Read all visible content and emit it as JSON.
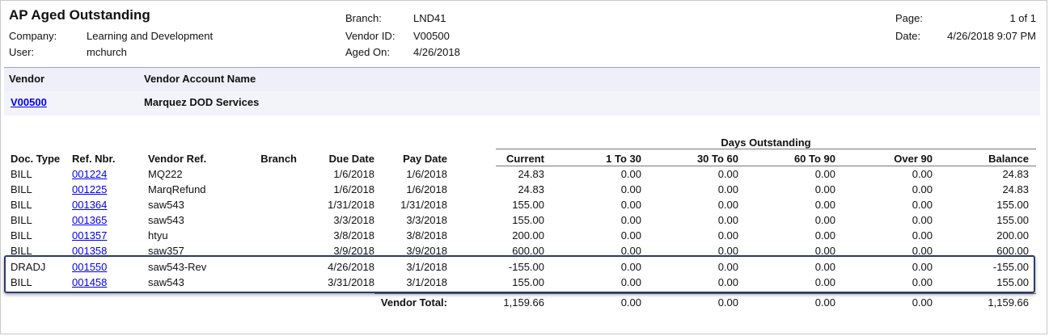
{
  "report": {
    "title": "AP Aged Outstanding",
    "company_label": "Company:",
    "company": "Learning and Development",
    "user_label": "User:",
    "user": "mchurch",
    "branch_label": "Branch:",
    "branch": "LND41",
    "vendor_id_label": "Vendor ID:",
    "vendor_id": "V00500",
    "aged_on_label": "Aged On:",
    "aged_on": "4/26/2018",
    "page_label": "Page:",
    "page": "1 of 1",
    "date_label": "Date:",
    "date": "4/26/2018 9:07 PM"
  },
  "vendor_header": {
    "vendor_col": "Vendor",
    "account_name_col": "Vendor Account Name",
    "vendor_code": "V00500",
    "vendor_name": "Marquez DOD Services"
  },
  "table": {
    "group_header": "Days Outstanding",
    "columns": [
      "Doc. Type",
      "Ref. Nbr.",
      "Vendor Ref.",
      "Branch",
      "Due Date",
      "Pay Date",
      "Current",
      "1 To 30",
      "30 To 60",
      "60 To 90",
      "Over 90",
      "Balance"
    ],
    "rows": [
      [
        "BILL",
        "001224",
        "MQ222",
        "",
        "1/6/2018",
        "1/6/2018",
        "24.83",
        "0.00",
        "0.00",
        "0.00",
        "0.00",
        "24.83"
      ],
      [
        "BILL",
        "001225",
        "MarqRefund",
        "",
        "1/6/2018",
        "1/6/2018",
        "24.83",
        "0.00",
        "0.00",
        "0.00",
        "0.00",
        "24.83"
      ],
      [
        "BILL",
        "001364",
        "saw543",
        "",
        "1/31/2018",
        "1/31/2018",
        "155.00",
        "0.00",
        "0.00",
        "0.00",
        "0.00",
        "155.00"
      ],
      [
        "BILL",
        "001365",
        "saw543",
        "",
        "3/3/2018",
        "3/3/2018",
        "155.00",
        "0.00",
        "0.00",
        "0.00",
        "0.00",
        "155.00"
      ],
      [
        "BILL",
        "001357",
        "htyu",
        "",
        "3/8/2018",
        "3/8/2018",
        "200.00",
        "0.00",
        "0.00",
        "0.00",
        "0.00",
        "200.00"
      ],
      [
        "BILL",
        "001358",
        "saw357",
        "",
        "3/9/2018",
        "3/9/2018",
        "600.00",
        "0.00",
        "0.00",
        "0.00",
        "0.00",
        "600.00"
      ],
      [
        "DRADJ",
        "001550",
        "saw543-Rev",
        "",
        "4/26/2018",
        "3/1/2018",
        "-155.00",
        "0.00",
        "0.00",
        "0.00",
        "0.00",
        "-155.00"
      ],
      [
        "BILL",
        "001458",
        "saw543",
        "",
        "3/31/2018",
        "3/1/2018",
        "155.00",
        "0.00",
        "0.00",
        "0.00",
        "0.00",
        "155.00"
      ]
    ],
    "total_label": "Vendor Total:",
    "totals": [
      "1,159.66",
      "0.00",
      "0.00",
      "0.00",
      "0.00",
      "1,159.66"
    ]
  },
  "colors": {
    "band_bg": "#eeeff8",
    "band_border": "#9ea4cc",
    "link": "#0000ee",
    "highlight_border": "#2c3a6e"
  }
}
